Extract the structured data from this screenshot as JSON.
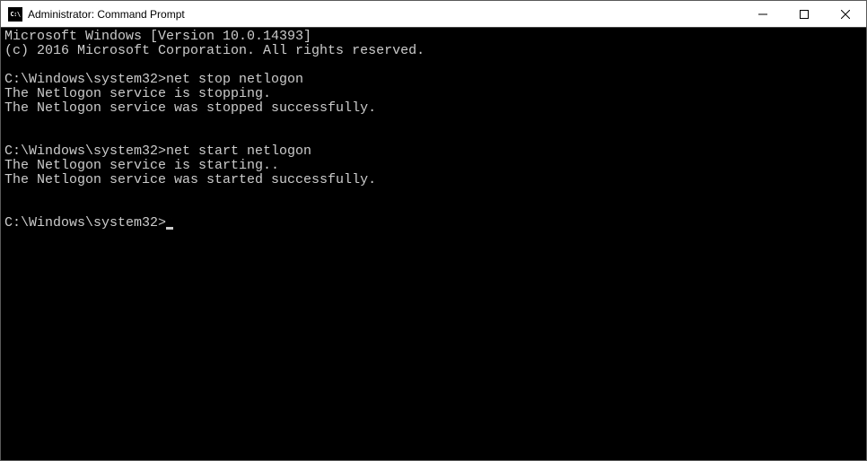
{
  "window": {
    "title": "Administrator: Command Prompt",
    "icon_label": "C:\\"
  },
  "terminal": {
    "lines": [
      "Microsoft Windows [Version 10.0.14393]",
      "(c) 2016 Microsoft Corporation. All rights reserved.",
      "",
      "C:\\Windows\\system32>net stop netlogon",
      "The Netlogon service is stopping.",
      "The Netlogon service was stopped successfully.",
      "",
      "",
      "C:\\Windows\\system32>net start netlogon",
      "The Netlogon service is starting..",
      "The Netlogon service was started successfully.",
      "",
      "",
      "C:\\Windows\\system32>"
    ],
    "prompt": "C:\\Windows\\system32>",
    "commands": [
      "net stop netlogon",
      "net start netlogon"
    ]
  }
}
